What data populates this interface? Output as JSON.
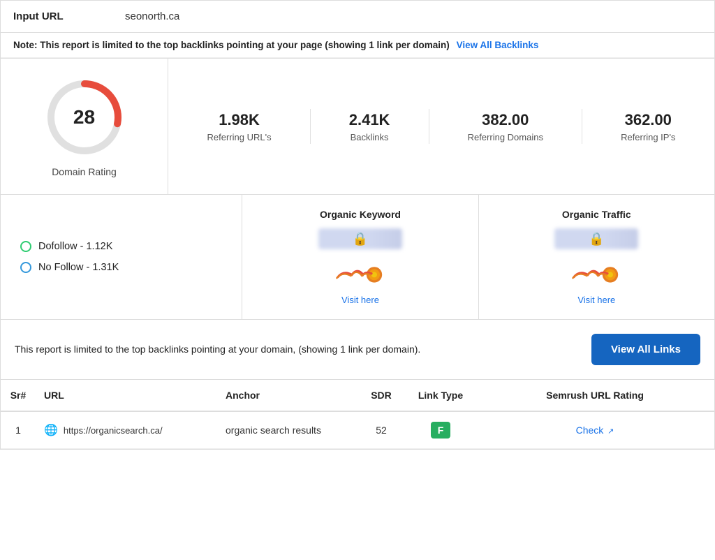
{
  "input_url": {
    "label": "Input URL",
    "value": "seonorth.ca"
  },
  "note": {
    "text": "Note: This report is limited to the top backlinks pointing at your page (showing 1 link per domain)",
    "link_text": "View All Backlinks",
    "link_href": "#"
  },
  "domain_rating": {
    "value": "28",
    "label": "Domain Rating",
    "gauge_fill_color": "#e74c3c",
    "gauge_bg_color": "#e0e0e0",
    "fill_percent": 28
  },
  "metrics": [
    {
      "value": "1.98K",
      "label": "Referring URL's"
    },
    {
      "value": "2.41K",
      "label": "Backlinks"
    },
    {
      "value": "382.00",
      "label": "Referring Domains"
    },
    {
      "value": "362.00",
      "label": "Referring IP's"
    }
  ],
  "link_types": {
    "dofollow": {
      "label": "Dofollow - 1.12K"
    },
    "nofollow": {
      "label": "No Follow - 1.31K"
    }
  },
  "organic_keyword": {
    "title": "Organic Keyword",
    "visit_label": "Visit here",
    "visit_href": "#"
  },
  "organic_traffic": {
    "title": "Organic Traffic",
    "visit_label": "Visit here",
    "visit_href": "#"
  },
  "view_all": {
    "text": "This report is limited to the top backlinks pointing at your domain, (showing 1 link per domain).",
    "button_label": "View All Links"
  },
  "table": {
    "headers": {
      "sr": "Sr#",
      "url": "URL",
      "anchor": "Anchor",
      "sdr": "SDR",
      "link_type": "Link Type",
      "semrush": "Semrush URL Rating"
    },
    "rows": [
      {
        "sr": "1",
        "url": "https://organicsearch.ca/",
        "anchor": "organic search results",
        "sdr": "52",
        "link_type": "F",
        "semrush_label": "Check",
        "semrush_href": "#"
      }
    ]
  }
}
